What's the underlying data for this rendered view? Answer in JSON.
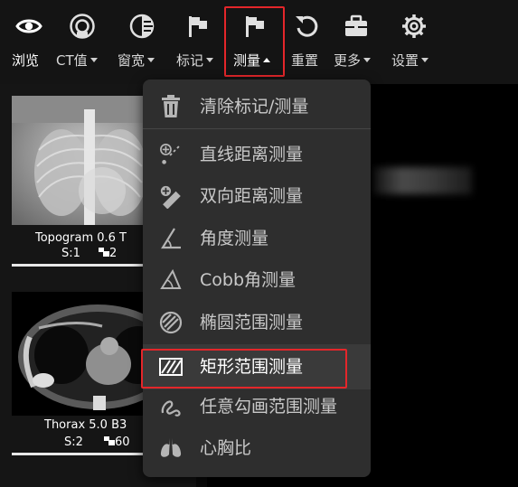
{
  "toolbar": {
    "tools": [
      {
        "id": "browse",
        "label": "浏览",
        "icon": "eye-icon",
        "dropdown": false
      },
      {
        "id": "ct",
        "label": "CT值",
        "icon": "ct-value-icon",
        "dropdown": true
      },
      {
        "id": "window",
        "label": "窗宽",
        "icon": "window-level-icon",
        "dropdown": true
      },
      {
        "id": "mark",
        "label": "标记",
        "icon": "flag-icon",
        "dropdown": true
      },
      {
        "id": "measure",
        "label": "测量",
        "icon": "flag-icon",
        "dropdown": true,
        "active": true
      },
      {
        "id": "reset",
        "label": "重置",
        "icon": "reset-icon",
        "dropdown": false
      },
      {
        "id": "more",
        "label": "更多",
        "icon": "toolbox-icon",
        "dropdown": true
      },
      {
        "id": "settings",
        "label": "设置",
        "icon": "gear-icon",
        "dropdown": true
      }
    ]
  },
  "series": [
    {
      "name": "Topogram  0.6  T",
      "s": "S:1",
      "count": "2"
    },
    {
      "name": "Thorax  5.0  B3",
      "s": "S:2",
      "count": "60"
    }
  ],
  "measure_menu": {
    "items": [
      {
        "label": "清除标记/测量",
        "icon": "trash-icon"
      },
      {
        "label": "直线距离测量",
        "icon": "line-distance-icon"
      },
      {
        "label": "双向距离测量",
        "icon": "bidirectional-distance-icon"
      },
      {
        "label": "角度测量",
        "icon": "angle-icon"
      },
      {
        "label": "Cobb角测量",
        "icon": "cobb-angle-icon"
      },
      {
        "label": "椭圆范围测量",
        "icon": "ellipse-roi-icon"
      },
      {
        "label": "矩形范围测量",
        "icon": "rectangle-roi-icon",
        "selected": true
      },
      {
        "label": "任意勾画范围测量",
        "icon": "freehand-roi-icon"
      },
      {
        "label": "心胸比",
        "icon": "cardiothoracic-ratio-icon"
      }
    ]
  },
  "colors": {
    "highlight_border": "#e4262a",
    "menu_bg": "#2e2e2e",
    "toolbar_bg": "#141414"
  }
}
